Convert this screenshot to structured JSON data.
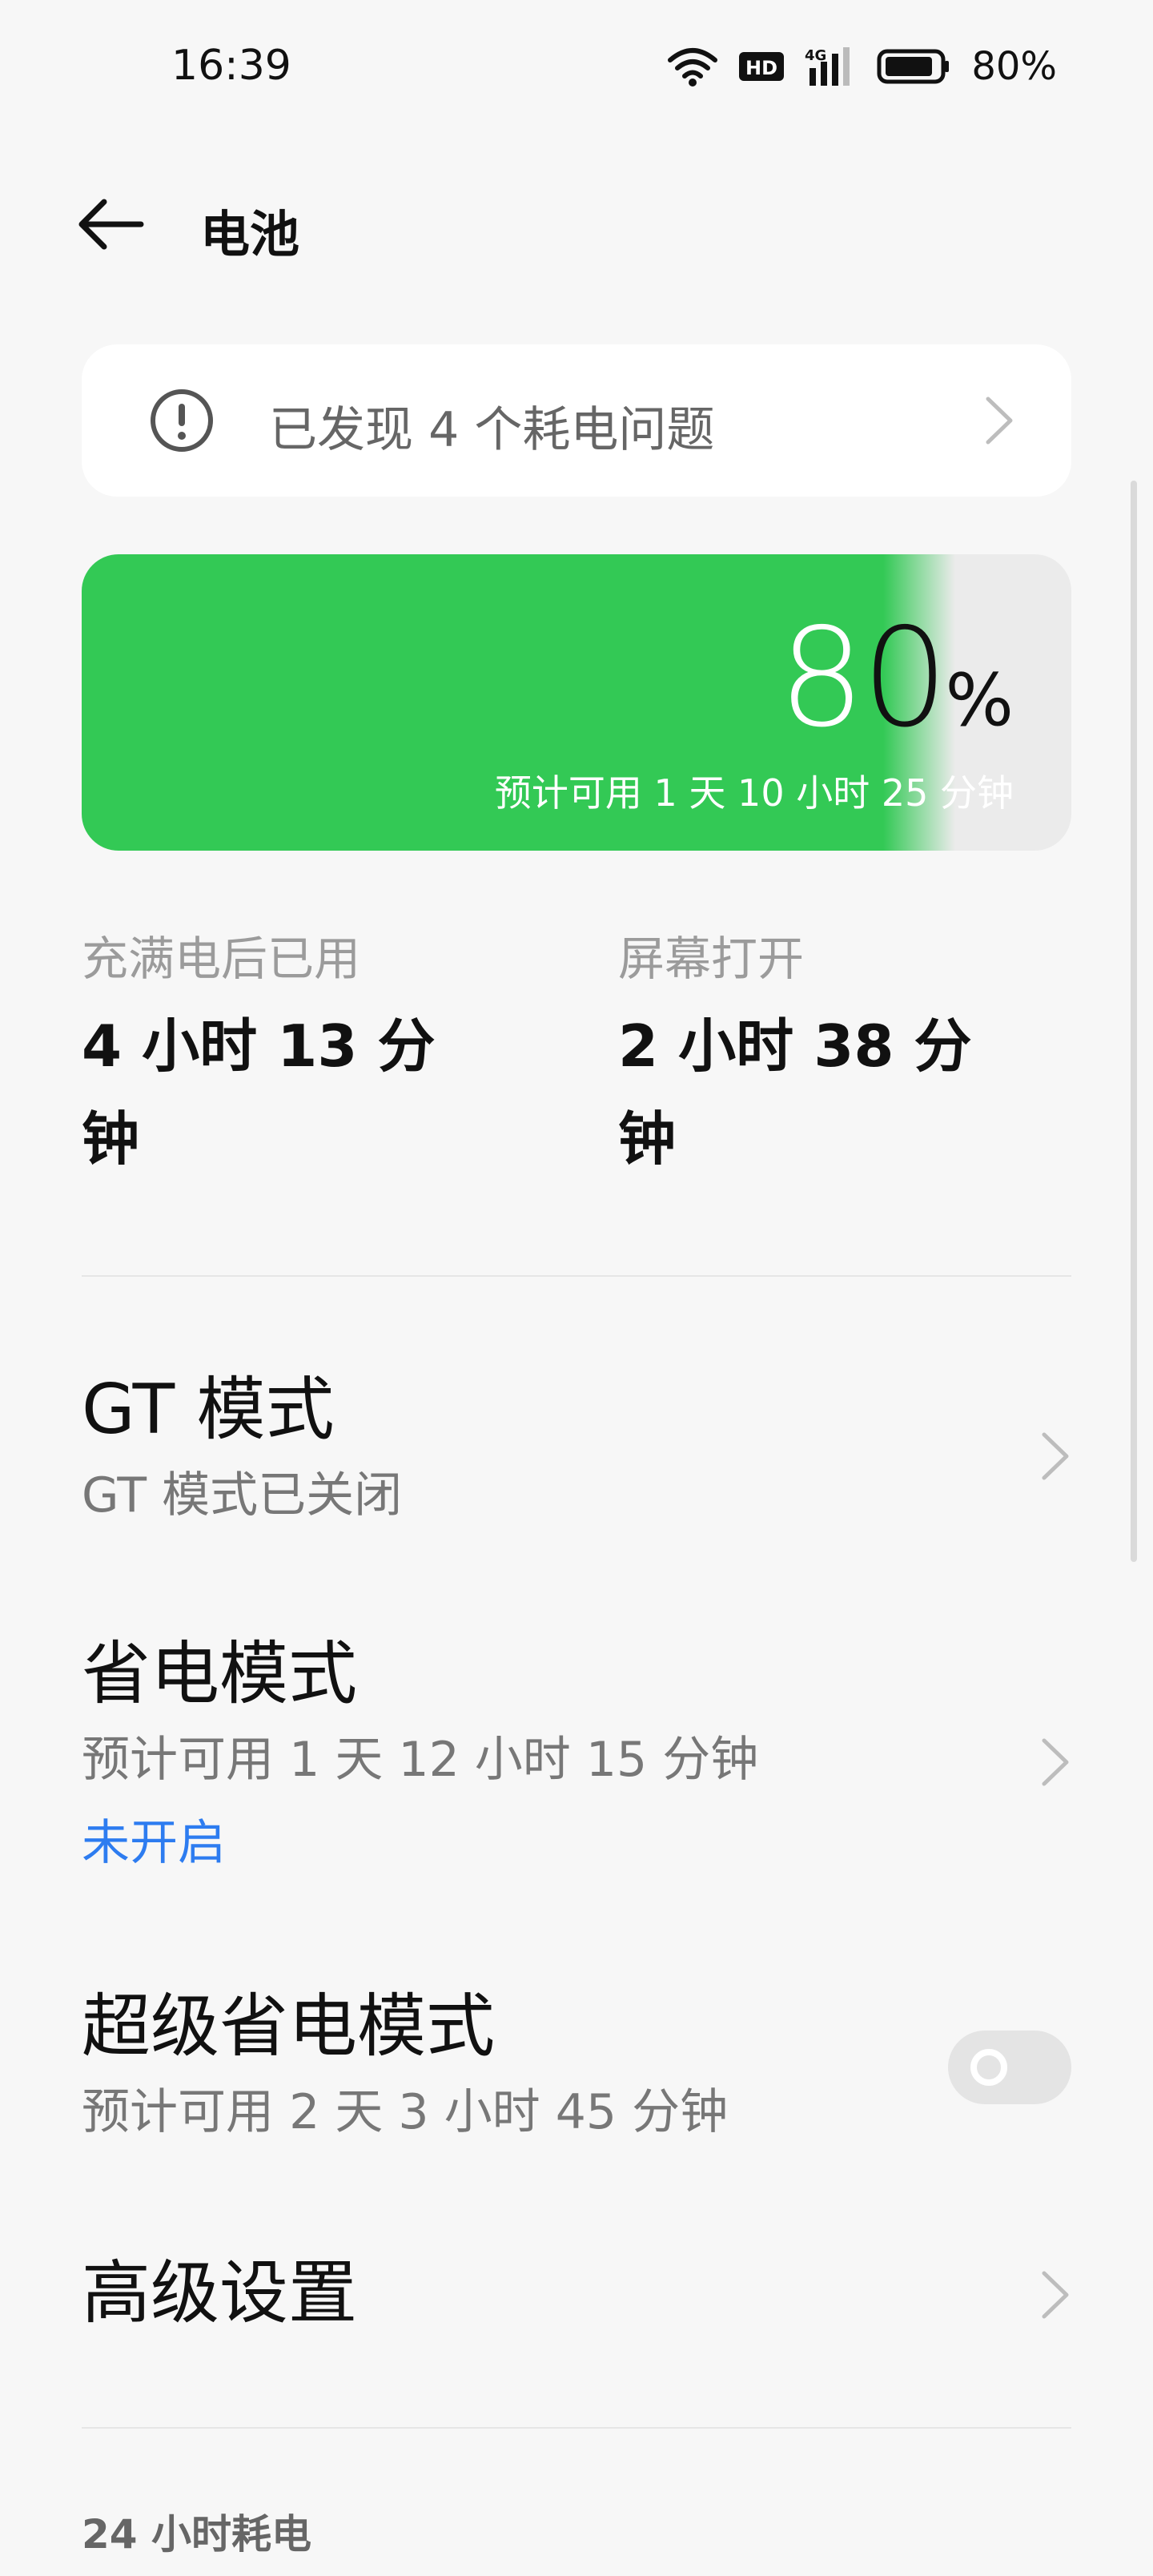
{
  "status_bar": {
    "time": "16:39",
    "battery_text": "80%",
    "icons": [
      "wifi-icon",
      "hd-icon",
      "signal-4g-icon",
      "battery-icon"
    ]
  },
  "header": {
    "title": "电池",
    "back_icon": "arrow-left-icon"
  },
  "issue_card": {
    "text": "已发现 4 个耗电问题",
    "icon": "alert-circle-icon"
  },
  "battery": {
    "percent_digits": "80",
    "percent_sign": "%",
    "level": 0.8,
    "estimate": "预计可用 1 天 10 小时 25 分钟",
    "fill_color": "#33C955"
  },
  "stats": {
    "since_charge_label": "充满电后已用",
    "since_charge_value_line1": "4 小时 13 分",
    "since_charge_value_line2": "钟",
    "screen_on_label": "屏幕打开",
    "screen_on_value_line1": "2 小时 38 分",
    "screen_on_value_line2": "钟"
  },
  "gt_mode": {
    "title": "GT 模式",
    "subtitle": "GT 模式已关闭"
  },
  "power_saving": {
    "title": "省电模式",
    "subtitle": "预计可用 1 天 12 小时 15 分钟",
    "status": "未开启",
    "status_color": "#2D7CF0"
  },
  "super_power_saving": {
    "title": "超级省电模式",
    "subtitle": "预计可用 2 天 3 小时 45 分钟",
    "enabled": false
  },
  "advanced": {
    "title": "高级设置"
  },
  "usage_section": {
    "label": "24 小时耗电"
  }
}
